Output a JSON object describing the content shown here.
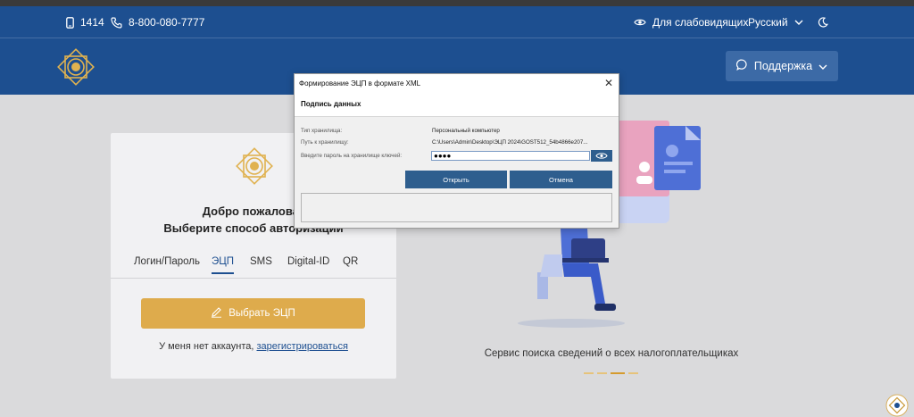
{
  "utility": {
    "short_phone": "1414",
    "phone": "8-800-080-7777",
    "accessibility": "Для слабовидящих",
    "language": "Русский"
  },
  "header": {
    "support_label": "Поддержка"
  },
  "login": {
    "welcome": "Добро пожаловат",
    "choose_method": "Выберите способ авторизации",
    "tabs": [
      "Логин/Пароль",
      "ЭЦП",
      "SMS",
      "Digital-ID",
      "QR"
    ],
    "active_tab": "ЭЦП",
    "select_ecp_label": "Выбрать ЭЦП",
    "no_account_text": "У меня нет аккаунта,",
    "register_link": "зарегистрироваться"
  },
  "promo": {
    "tagline": "Сервис поиска сведений о всех налогоплательщиках",
    "slides": 4,
    "active_slide": 3
  },
  "dialog": {
    "title": "Формирование ЭЦП в формате XML",
    "heading": "Подпись данных",
    "storage_type_label": "Тип хранилища:",
    "storage_type_value": "Персональный компьютер",
    "storage_path_label": "Путь к хранилищу:",
    "storage_path_value": "C:\\Users\\Admin\\Desktop\\ЭЦП 2024\\GOST512_54b4866e207...",
    "password_label": "Введите пароль на хранилище ключей:",
    "password_value": "●●●●",
    "open_label": "Открыть",
    "cancel_label": "Отмена"
  },
  "colors": {
    "header": "#1d4f90",
    "accent_gold": "#deab4c",
    "dialog_button": "#2e5e8e"
  }
}
